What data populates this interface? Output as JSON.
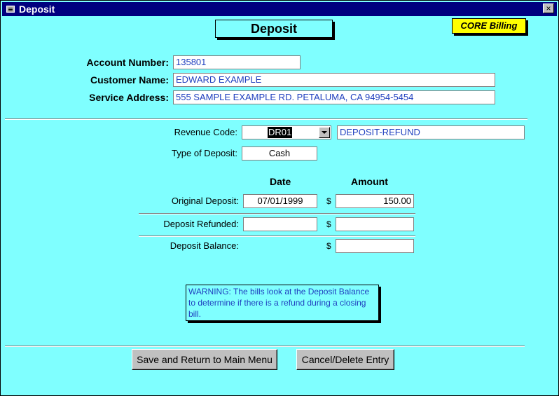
{
  "window": {
    "title": "Deposit",
    "close_glyph": "×"
  },
  "form": {
    "heading": "Deposit",
    "badge": "CORE Billing",
    "account_number_label": "Account Number:",
    "account_number": "135801",
    "customer_name_label": "Customer Name:",
    "customer_name": "EDWARD EXAMPLE",
    "service_address_label": "Service Address:",
    "service_address": "555 SAMPLE EXAMPLE RD. PETALUMA, CA  94954-5454",
    "revenue_code_label": "Revenue Code:",
    "revenue_code": "DR01",
    "revenue_code_desc": "DEPOSIT-REFUND",
    "type_label": "Type of Deposit:",
    "type_value": "Cash",
    "col_date": "Date",
    "col_amount": "Amount",
    "original_label": "Original Deposit:",
    "original_date": "07/01/1999",
    "original_amount": "150.00",
    "refunded_label": "Deposit Refunded:",
    "refunded_date": "",
    "refunded_amount": "",
    "balance_label": "Deposit Balance:",
    "balance_amount": "",
    "currency": "$",
    "warning": "WARNING:  The bills look at the Deposit Balance to determine if there is a refund during a closing bill.",
    "save_button": "Save and Return to Main Menu",
    "cancel_button": "Cancel/Delete Entry"
  },
  "colors": {
    "background": "#7fffff",
    "titlebar": "#00007f",
    "badge": "#ffff00",
    "field_text": "#1f3fbf"
  },
  "icons": {
    "window_icon": "form-icon",
    "close": "close-icon",
    "dropdown": "chevron-down-icon"
  }
}
